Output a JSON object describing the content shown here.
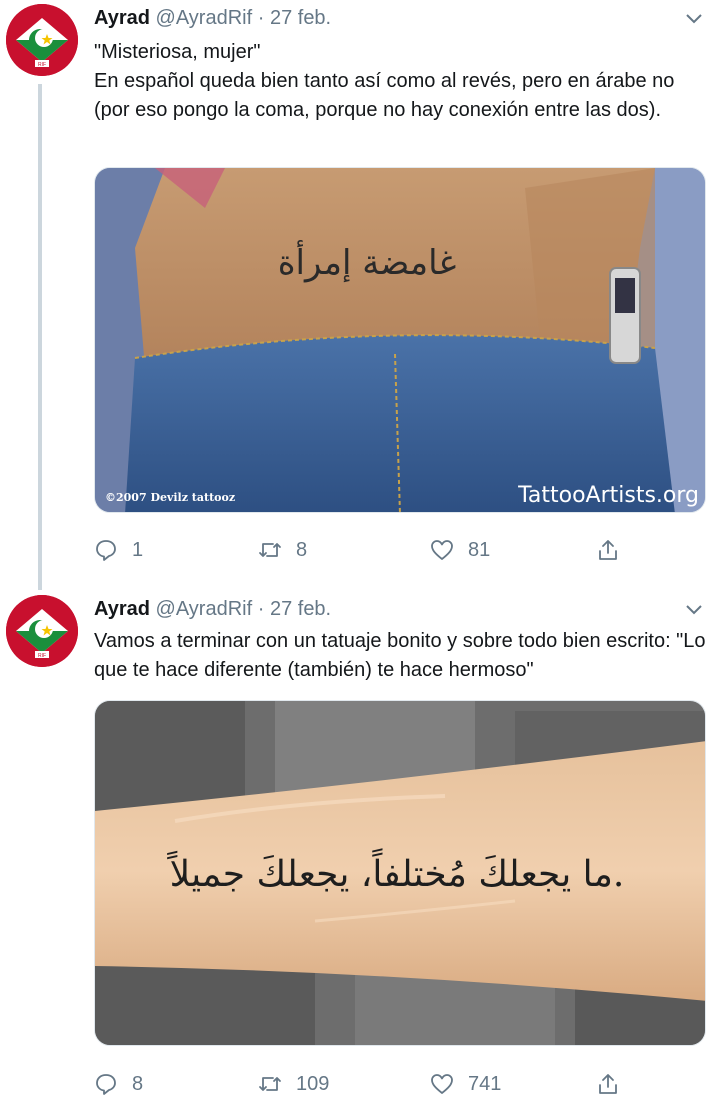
{
  "tweets": [
    {
      "name": "Ayrad",
      "handle": "@AyradRif",
      "dot": "·",
      "date": "27 feb.",
      "text": "\"Misteriosa, mujer\"\nEn español queda bien tanto así como al revés, pero en árabe no (por eso pongo la coma, porque no hay conexión entre las dos).",
      "image": {
        "tattoo_text": "غامضة إمرأة",
        "watermark_left": "©2007 Devilz tattooz",
        "watermark_right": "TattooArtists.org"
      },
      "replies": "1",
      "retweets": "8",
      "likes": "81"
    },
    {
      "name": "Ayrad",
      "handle": "@AyradRif",
      "dot": "·",
      "date": "27 feb.",
      "text": "Vamos a terminar con un tatuaje bonito y sobre todo bien escrito: \"Lo que te hace diferente (también) te hace hermoso\"",
      "image": {
        "tattoo_text": "ما يجعلكَ مُختلفاً، يجعلكَ جميلاً."
      },
      "replies": "8",
      "retweets": "109",
      "likes": "741"
    }
  ],
  "avatar": {
    "label": "RIF",
    "colors": {
      "red": "#c8102e",
      "white": "#ffffff",
      "green": "#1a8f3c",
      "star": "#f5c400"
    }
  },
  "colors": {
    "text": "#14171a",
    "secondary": "#657786",
    "divider": "#ccd6dd"
  }
}
